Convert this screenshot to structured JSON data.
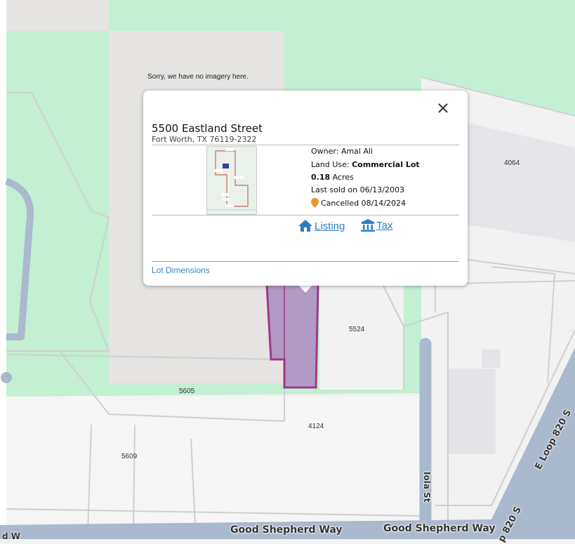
{
  "map": {
    "no_imagery_text": "Sorry, we have no imagery here.",
    "parcel_labels": [
      "4064",
      "5524",
      "5605",
      "4124",
      "5609"
    ],
    "streets": {
      "good_shepherd_left": "Good Shepherd Way",
      "good_shepherd_right": "Good Shepherd Way",
      "iola": "Iola St",
      "e_loop": "E Loop 820 S",
      "loop_bottom": "p 820 S",
      "left_edge": "d W"
    },
    "colors": {
      "park": "#c3efd3",
      "gray_area": "#e5e4e2",
      "road": "#aab9cc",
      "selected_parcel": "#b19ac4",
      "parcel_outline": "#9b3a8a"
    }
  },
  "popup": {
    "address": "5500 Eastland Street",
    "city": "Fort Worth, TX 76119-2322",
    "owner_label": "Owner:",
    "owner_value": "Amal Ali",
    "land_use_label": "Land Use:",
    "land_use_value": "Commercial Lot",
    "acres_value": "0.18",
    "acres_unit": "Acres",
    "last_sold": "Last sold on 06/13/2003",
    "status": "Cancelled 08/14/2024",
    "status_color": "#e8962f",
    "listing_label": "Listing",
    "tax_label": "Tax",
    "lot_dimensions_label": "Lot Dimensions",
    "icons": {
      "close": "close-icon",
      "pin": "map-pin-icon",
      "home": "home-icon",
      "bank": "bank-icon"
    }
  }
}
